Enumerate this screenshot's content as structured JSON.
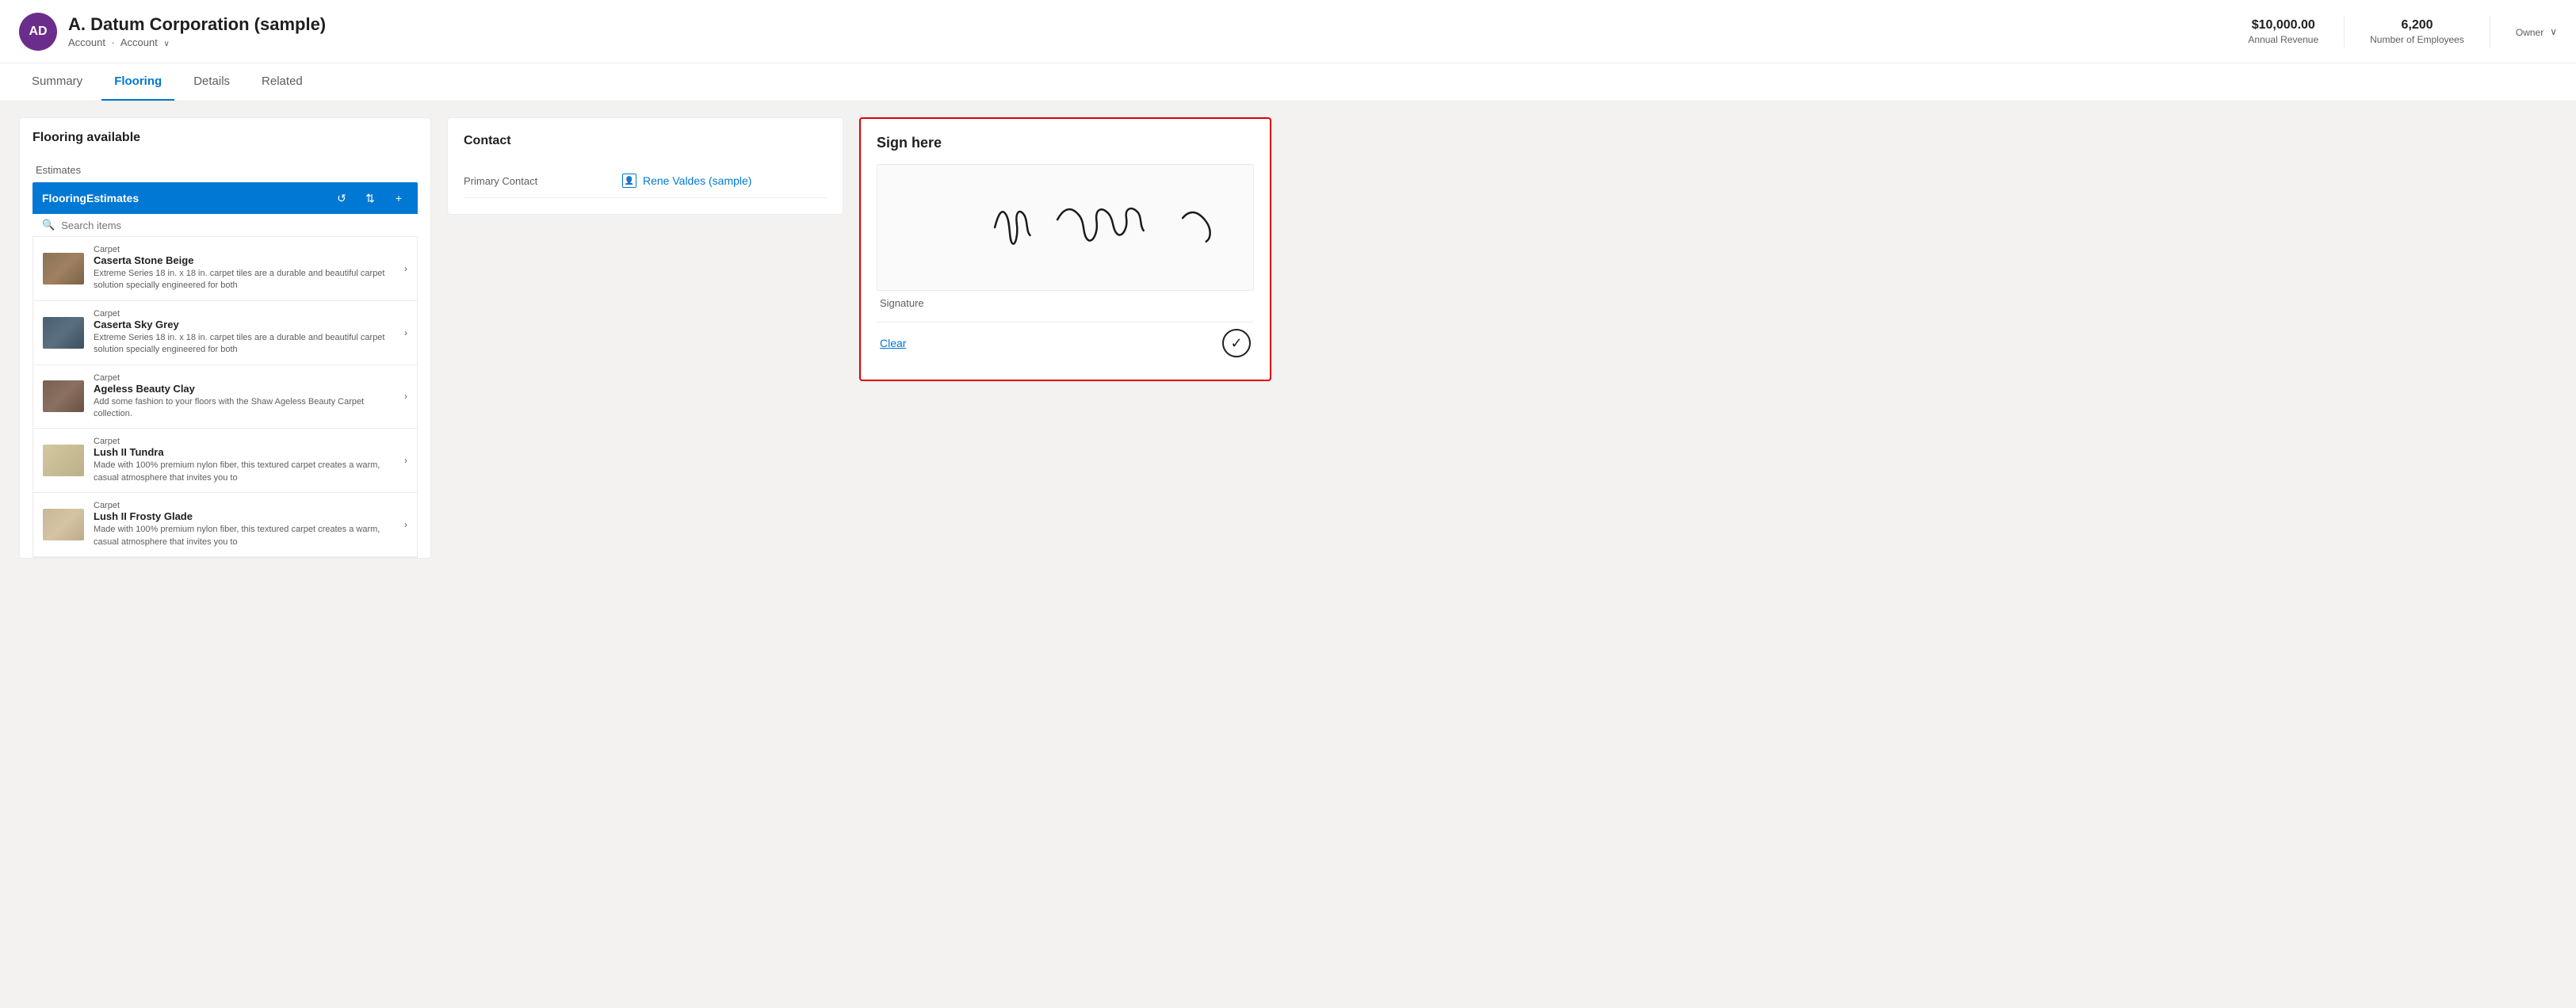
{
  "header": {
    "avatar_initials": "AD",
    "avatar_bg": "#6b2d8b",
    "title": "A. Datum Corporation (sample)",
    "breadcrumb_1": "Account",
    "breadcrumb_sep": "·",
    "breadcrumb_2": "Account",
    "breadcrumb_chevron": "∨",
    "annual_revenue_value": "$10,000.00",
    "annual_revenue_label": "Annual Revenue",
    "employees_value": "6,200",
    "employees_label": "Number of Employees",
    "owner_label": "Owner",
    "owner_chevron": "∨"
  },
  "nav": {
    "tabs": [
      {
        "id": "summary",
        "label": "Summary",
        "active": false
      },
      {
        "id": "flooring",
        "label": "Flooring",
        "active": true
      },
      {
        "id": "details",
        "label": "Details",
        "active": false
      },
      {
        "id": "related",
        "label": "Related",
        "active": false
      }
    ]
  },
  "flooring_panel": {
    "title": "Flooring available",
    "subgrid_name": "FlooringEstimates",
    "refresh_icon": "↺",
    "filter_icon": "⇅",
    "add_icon": "+",
    "search_placeholder": "Search items",
    "estimates_label": "Estimates",
    "items": [
      {
        "type": "Carpet",
        "name": "Caserta Stone Beige",
        "desc": "Extreme Series 18 in. x 18 in. carpet tiles are a durable and beautiful carpet solution specially engineered for both",
        "color_class": "carpet-caserta-beige"
      },
      {
        "type": "Carpet",
        "name": "Caserta Sky Grey",
        "desc": "Extreme Series 18 in. x 18 in. carpet tiles are a durable and beautiful carpet solution specially engineered for both",
        "color_class": "carpet-caserta-grey"
      },
      {
        "type": "Carpet",
        "name": "Ageless Beauty Clay",
        "desc": "Add some fashion to your floors with the Shaw Ageless Beauty Carpet collection.",
        "color_class": "carpet-ageless-clay"
      },
      {
        "type": "Carpet",
        "name": "Lush II Tundra",
        "desc": "Made with 100% premium nylon fiber, this textured carpet creates a warm, casual atmosphere that invites you to",
        "color_class": "carpet-lush-tundra"
      },
      {
        "type": "Carpet",
        "name": "Lush II Frosty Glade",
        "desc": "Made with 100% premium nylon fiber, this textured carpet creates a warm, casual atmosphere that invites you to",
        "color_class": "carpet-lush-frosty"
      }
    ]
  },
  "contact_panel": {
    "title": "Contact",
    "primary_contact_label": "Primary Contact",
    "primary_contact_name": "Rene Valdes (sample)"
  },
  "sign_panel": {
    "title": "Sign here",
    "signature_label": "Signature",
    "clear_label": "Clear",
    "confirm_icon": "✓"
  }
}
